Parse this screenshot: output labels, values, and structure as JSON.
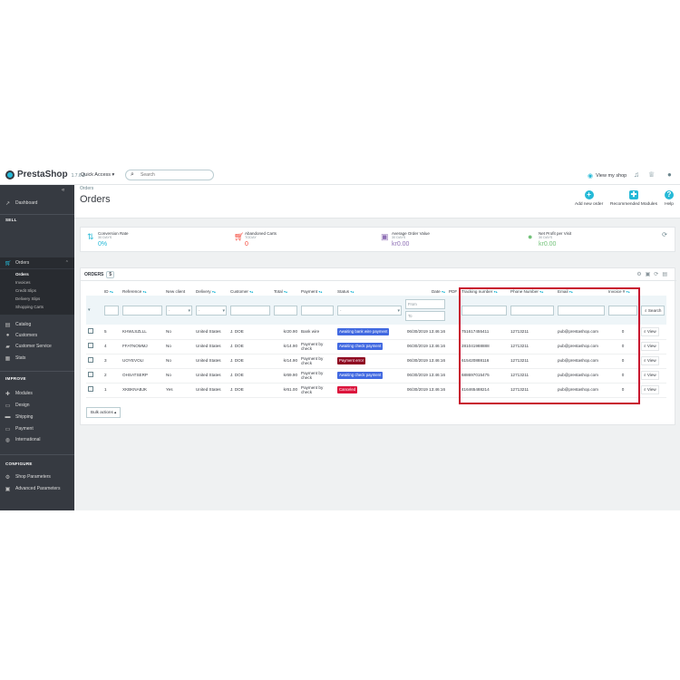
{
  "app": {
    "logo_text": "PrestaShop",
    "version": "1.7.6.0",
    "quick_access": "Quick Access ▾",
    "search_placeholder": "Search",
    "view_my_shop": "View my shop"
  },
  "sidebar": {
    "dashboard": "Dashboard",
    "sell_header": "SELL",
    "orders": "Orders",
    "orders_sub": [
      "Orders",
      "Invoices",
      "Credit Slips",
      "Delivery Slips",
      "Shopping Carts"
    ],
    "catalog": "Catalog",
    "customers": "Customers",
    "customer_service": "Customer Service",
    "stats": "Stats",
    "improve_header": "IMPROVE",
    "modules": "Modules",
    "design": "Design",
    "shipping": "Shipping",
    "payment": "Payment",
    "international": "International",
    "configure_header": "CONFIGURE",
    "shop_parameters": "Shop Parameters",
    "advanced_parameters": "Advanced Parameters"
  },
  "page": {
    "breadcrumb": "Orders",
    "title": "Orders",
    "toolbar": {
      "add_new_order": "Add new order",
      "recommended_modules": "Recommended Modules",
      "help": "Help"
    }
  },
  "kpis": [
    {
      "title": "Conversion Rate",
      "subtitle": "30 DAYS",
      "value": "0%",
      "color": "#25b9d7",
      "icon": "conversion-icon"
    },
    {
      "title": "Abandoned Carts",
      "subtitle": "TODAY",
      "value": "0",
      "color": "#f54c3e",
      "icon": "cart-icon"
    },
    {
      "title": "Average Order Value",
      "subtitle": "30 DAYS",
      "value": "kr0.00",
      "color": "#8e6fb5",
      "icon": "money-icon"
    },
    {
      "title": "Net Profit per Visit",
      "subtitle": "30 DAYS",
      "value": "kr0.00",
      "color": "#72c279",
      "icon": "person-icon"
    }
  ],
  "orders_panel": {
    "title": "ORDERS",
    "count": "5",
    "columns": [
      "ID",
      "Reference",
      "New client",
      "Delivery",
      "Customer",
      "Total",
      "Payment",
      "Status",
      "Date",
      "PDF",
      "Tracking number",
      "Phone Number",
      "Email",
      "Invoice #"
    ],
    "filters": {
      "date_from": "From",
      "date_to": "To",
      "select_default": "-",
      "search": "Search"
    },
    "rows": [
      {
        "id": "5",
        "reference": "KHWLSZLLL",
        "new_client": "No",
        "delivery": "United States",
        "customer": "J. DOE",
        "total": "kr20.90",
        "payment": "Bank wire",
        "status": "Awaiting bank wire payment",
        "status_color": "#4169e1",
        "date": "06/30/2019 13:46:16",
        "tracking": "751617455411",
        "phone": "12713211",
        "email": "pub@prestashop.com",
        "invoice": "0"
      },
      {
        "id": "4",
        "reference": "FFATNOMMJ",
        "new_client": "No",
        "delivery": "United States",
        "customer": "J. DOE",
        "total": "kr14.90",
        "payment": "Payment by check",
        "status": "Awaiting check payment",
        "status_color": "#4169e1",
        "date": "06/30/2019 13:46:16",
        "tracking": "281041988888",
        "phone": "12713211",
        "email": "pub@prestashop.com",
        "invoice": "0"
      },
      {
        "id": "3",
        "reference": "UOYEVOLI",
        "new_client": "No",
        "delivery": "United States",
        "customer": "J. DOE",
        "total": "kr14.90",
        "payment": "Payment by check",
        "status": "Payment error",
        "status_color": "#8f0621",
        "date": "06/30/2019 13:46:16",
        "tracking": "615420888116",
        "phone": "12713211",
        "email": "pub@prestashop.com",
        "invoice": "0"
      },
      {
        "id": "2",
        "reference": "OHSATSERP",
        "new_client": "No",
        "delivery": "United States",
        "customer": "J. DOE",
        "total": "kr69.90",
        "payment": "Payment by check",
        "status": "Awaiting check payment",
        "status_color": "#4169e1",
        "date": "06/30/2019 13:46:16",
        "tracking": "688697015475",
        "phone": "12713211",
        "email": "pub@prestashop.com",
        "invoice": "0"
      },
      {
        "id": "1",
        "reference": "XKBKNABJK",
        "new_client": "Yes",
        "delivery": "United States",
        "customer": "J. DOE",
        "total": "kr61.00",
        "payment": "Payment by check",
        "status": "Canceled",
        "status_color": "#dc143c",
        "date": "06/30/2019 13:46:16",
        "tracking": "416465488214",
        "phone": "12713211",
        "email": "pub@prestashop.com",
        "invoice": "0"
      }
    ],
    "view_label": "View",
    "bulk_actions": "Bulk actions ▴"
  },
  "colors": {
    "accent": "#25b9d7",
    "sidebar_bg": "#363a41",
    "highlight": "#c8102e"
  }
}
